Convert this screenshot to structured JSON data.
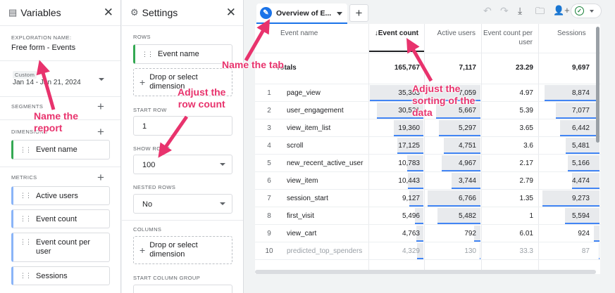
{
  "variables_panel": {
    "title": "Variables",
    "exploration_name_label": "EXPLORATION NAME:",
    "exploration_name": "Free form - Events",
    "date_range_label": "Custom",
    "date_range": "Jan 14 - Jan 21, 2024",
    "segments_label": "SEGMENTS",
    "dimensions_label": "DIMENSIONS",
    "dimensions": [
      "Event name"
    ],
    "metrics_label": "METRICS",
    "metrics": [
      "Active users",
      "Event count",
      "Event count per user",
      "Sessions"
    ]
  },
  "settings_panel": {
    "title": "Settings",
    "rows_label": "ROWS",
    "rows": [
      "Event name"
    ],
    "drop_dimension": "Drop or select dimension",
    "start_row_label": "START ROW",
    "start_row": "1",
    "show_rows_label": "SHOW ROWS",
    "show_rows": "100",
    "nested_rows_label": "NESTED ROWS",
    "nested_rows": "No",
    "columns_label": "COLUMNS",
    "start_column_group_label": "START COLUMN GROUP"
  },
  "tab": {
    "label": "Overview of E..."
  },
  "table": {
    "headers": [
      "Event name",
      "Event count",
      "Active users",
      "Event count per user",
      "Sessions"
    ],
    "totals_label": "Totals",
    "totals": [
      "165,767",
      "7,117",
      "23.29",
      "9,697"
    ],
    "max": {
      "event_count": 35303,
      "active_users": 7059,
      "sessions": 9697
    },
    "rows": [
      {
        "idx": "1",
        "name": "page_view",
        "event_count": "35,303",
        "active_users": "7,059",
        "per_user": "4.97",
        "sessions": "8,874",
        "ec": 35303,
        "au": 7059,
        "se": 8874
      },
      {
        "idx": "2",
        "name": "user_engagement",
        "event_count": "30,521",
        "active_users": "5,667",
        "per_user": "5.39",
        "sessions": "7,077",
        "ec": 30521,
        "au": 5667,
        "se": 7077
      },
      {
        "idx": "3",
        "name": "view_item_list",
        "event_count": "19,360",
        "active_users": "5,297",
        "per_user": "3.65",
        "sessions": "6,442",
        "ec": 19360,
        "au": 5297,
        "se": 6442
      },
      {
        "idx": "4",
        "name": "scroll",
        "event_count": "17,125",
        "active_users": "4,751",
        "per_user": "3.6",
        "sessions": "5,481",
        "ec": 17125,
        "au": 4751,
        "se": 5481
      },
      {
        "idx": "5",
        "name": "new_recent_active_user",
        "event_count": "10,783",
        "active_users": "4,967",
        "per_user": "2.17",
        "sessions": "5,166",
        "ec": 10783,
        "au": 4967,
        "se": 5166
      },
      {
        "idx": "6",
        "name": "view_item",
        "event_count": "10,443",
        "active_users": "3,744",
        "per_user": "2.79",
        "sessions": "4,474",
        "ec": 10443,
        "au": 3744,
        "se": 4474
      },
      {
        "idx": "7",
        "name": "session_start",
        "event_count": "9,127",
        "active_users": "6,766",
        "per_user": "1.35",
        "sessions": "9,273",
        "ec": 9127,
        "au": 6766,
        "se": 9273
      },
      {
        "idx": "8",
        "name": "first_visit",
        "event_count": "5,496",
        "active_users": "5,482",
        "per_user": "1",
        "sessions": "5,594",
        "ec": 5496,
        "au": 5482,
        "se": 5594
      },
      {
        "idx": "9",
        "name": "view_cart",
        "event_count": "4,763",
        "active_users": "792",
        "per_user": "6.01",
        "sessions": "924",
        "ec": 4763,
        "au": 792,
        "se": 924
      },
      {
        "idx": "10",
        "name": "predicted_top_spenders",
        "event_count": "4,329",
        "active_users": "130",
        "per_user": "33.3",
        "sessions": "87",
        "ec": 4329,
        "au": 130,
        "se": 87
      }
    ]
  },
  "annotations": {
    "name_report": "Name the\nreport",
    "name_tab": "Name the tab",
    "adjust_rows": "Adjust the\nrow count",
    "adjust_sorting": "Adjust the\nsorting of the\ndata"
  },
  "colors": {
    "accent": "#1a73e8",
    "annotation": "#e8336d",
    "dimension": "#34a853",
    "metric": "#8ab4f8",
    "bar": "#4285f4"
  }
}
